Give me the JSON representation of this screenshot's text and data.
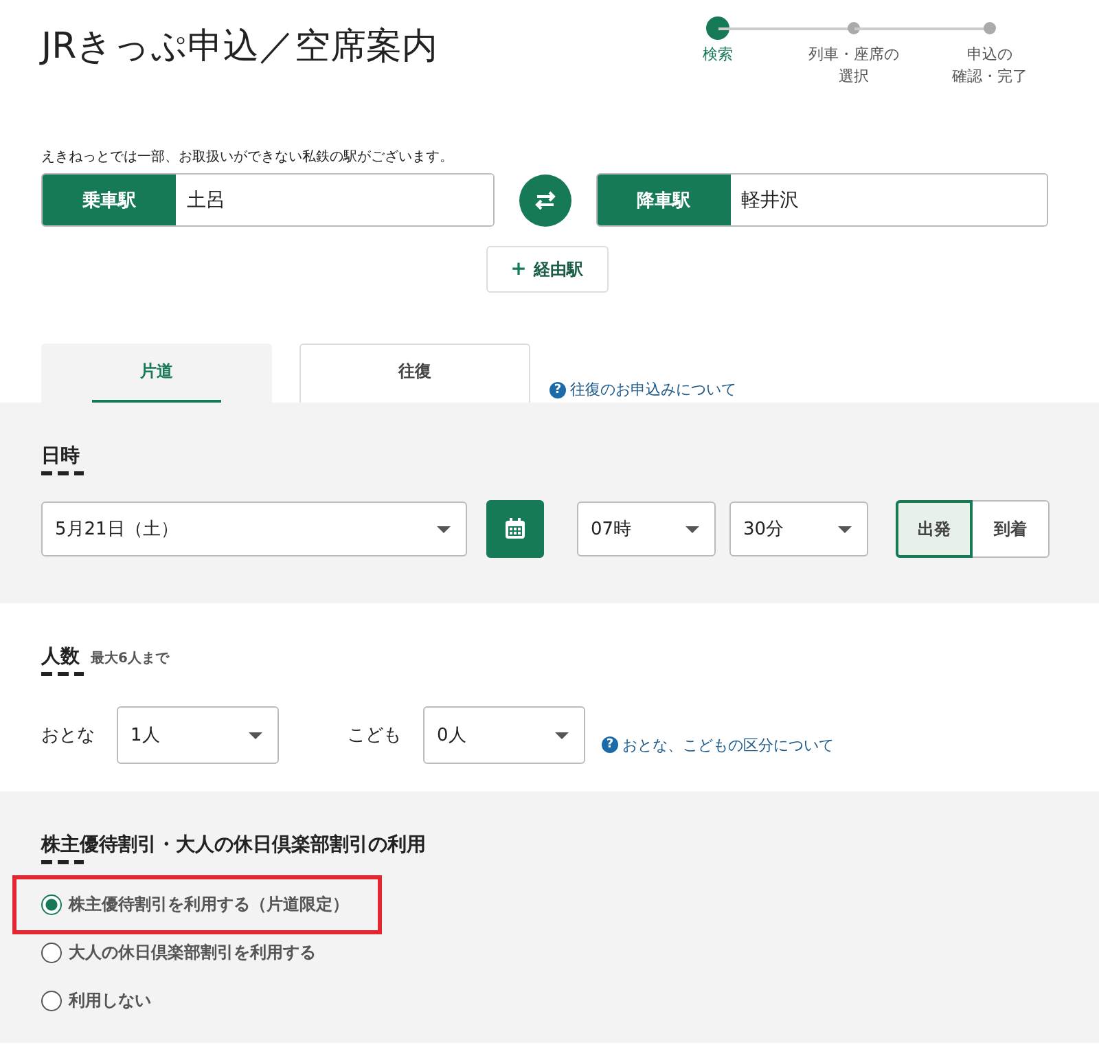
{
  "title": "JRきっぷ申込／空席案内",
  "steps": [
    {
      "lines": [
        "検索"
      ],
      "selected": true
    },
    {
      "lines": [
        "列車・座席の",
        "選択"
      ],
      "selected": false
    },
    {
      "lines": [
        "申込の",
        "確認・完了"
      ],
      "selected": false
    }
  ],
  "notice": "えきねっとでは一部、お取扱いができない私鉄の駅がございます。",
  "departure": {
    "label": "乗車駅",
    "value": "土呂"
  },
  "arrival": {
    "label": "降車駅",
    "value": "軽井沢"
  },
  "via_button": {
    "icon": "+",
    "label": "経由駅"
  },
  "tabs": [
    {
      "label": "片道",
      "selected": true
    },
    {
      "label": "往復",
      "selected": false
    }
  ],
  "round_trip_link": {
    "icon": "?",
    "label": "往復のお申込みについて"
  },
  "datetime": {
    "heading": "日時",
    "date": "5月21日（土）",
    "hour": "07時",
    "minute": "30分",
    "modes": [
      {
        "label": "出発",
        "selected": true
      },
      {
        "label": "到着",
        "selected": false
      }
    ]
  },
  "passengers": {
    "heading": "人数",
    "note": "最大6人まで",
    "adult_label": "おとな",
    "adult": "1人",
    "child_label": "こども",
    "child": "0人",
    "link": {
      "icon": "?",
      "label": "おとな、こどもの区分について"
    }
  },
  "discount": {
    "heading": "株主優待割引・大人の休日倶楽部割引の利用",
    "options": [
      {
        "label": "株主優待割引を利用する（片道限定）",
        "selected": true,
        "highlighted": true
      },
      {
        "label": "大人の休日倶楽部割引を利用する",
        "selected": false,
        "highlighted": false
      },
      {
        "label": "利用しない",
        "selected": false,
        "highlighted": false
      }
    ]
  }
}
